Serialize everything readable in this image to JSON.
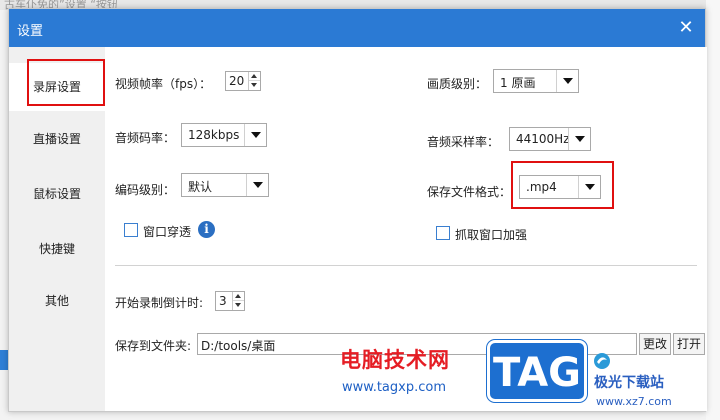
{
  "background": {
    "top_text": "古车仆免的”设置 “按钮"
  },
  "dialog": {
    "title": "设置",
    "close_glyph": "✕"
  },
  "sidebar": {
    "items": [
      {
        "label": "录屏设置",
        "active": true
      },
      {
        "label": "直播设置",
        "active": false
      },
      {
        "label": "鼠标设置",
        "active": false
      },
      {
        "label": "快捷键",
        "active": false
      },
      {
        "label": "其他",
        "active": false
      }
    ]
  },
  "form": {
    "fps_label": "视频帧率（fps）：",
    "fps_value": "20",
    "quality_label": "画质级别：",
    "quality_value": "1 原画",
    "audio_bitrate_label": "音频码率：",
    "audio_bitrate_value": "128kbps",
    "sample_rate_label": "音频采样率：",
    "sample_rate_value": "44100Hz",
    "encode_level_label": "编码级别：",
    "encode_level_value": "默认",
    "format_label": "保存文件格式：",
    "format_value": ".mp4",
    "window_through_label": "窗口穿透",
    "window_through_checked": false,
    "capture_boost_label": "抓取窗口加强",
    "capture_boost_checked": false,
    "countdown_label": "开始录制倒计时:",
    "countdown_value": "3",
    "save_folder_label": "保存到文件夹:",
    "save_folder_value": "D:/tools/桌面",
    "change_button": "更改",
    "open_button": "打开"
  },
  "icons": {
    "info": "i"
  },
  "colors": {
    "titlebar": "#2b7ad4",
    "highlight": "#e01010",
    "checkbox_border": "#3a7fd0"
  },
  "watermark": {
    "site_name": "电脑技术网",
    "site_url": "www.tagxp.com",
    "tag": "TAG",
    "brand": "极光下载站",
    "brand_url": "www.xz7.com"
  }
}
